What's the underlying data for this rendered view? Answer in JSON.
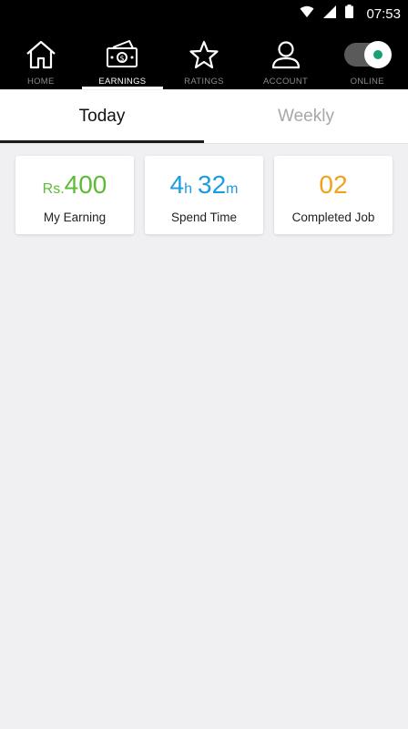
{
  "status_bar": {
    "time": "07:53",
    "icons": [
      "wifi-icon",
      "signal-icon",
      "battery-icon"
    ]
  },
  "nav": {
    "items": [
      {
        "label": "HOME",
        "icon": "home-icon",
        "active": false
      },
      {
        "label": "EARNINGS",
        "icon": "earnings-icon",
        "active": true
      },
      {
        "label": "RATINGS",
        "icon": "star-icon",
        "active": false
      },
      {
        "label": "ACCOUNT",
        "icon": "account-icon",
        "active": false
      },
      {
        "label": "ONLINE",
        "icon": "online-toggle",
        "active": false,
        "toggle_on": true
      }
    ]
  },
  "tabs": {
    "today": "Today",
    "weekly": "Weekly",
    "selected": "today"
  },
  "cards": [
    {
      "prefix": "Rs.",
      "value": "400",
      "label": "My Earning",
      "color": "#5dbb36"
    },
    {
      "hours": "4",
      "hours_unit": "h",
      "minutes": "32",
      "minutes_unit": "m",
      "label": "Spend Time",
      "color": "#1e9be3"
    },
    {
      "value": "02",
      "label": "Completed Job",
      "color": "#f0a21c"
    }
  ],
  "colors": {
    "nav_bg": "#000000",
    "page_bg": "#f0f0f2",
    "online_dot": "#1aa073"
  }
}
